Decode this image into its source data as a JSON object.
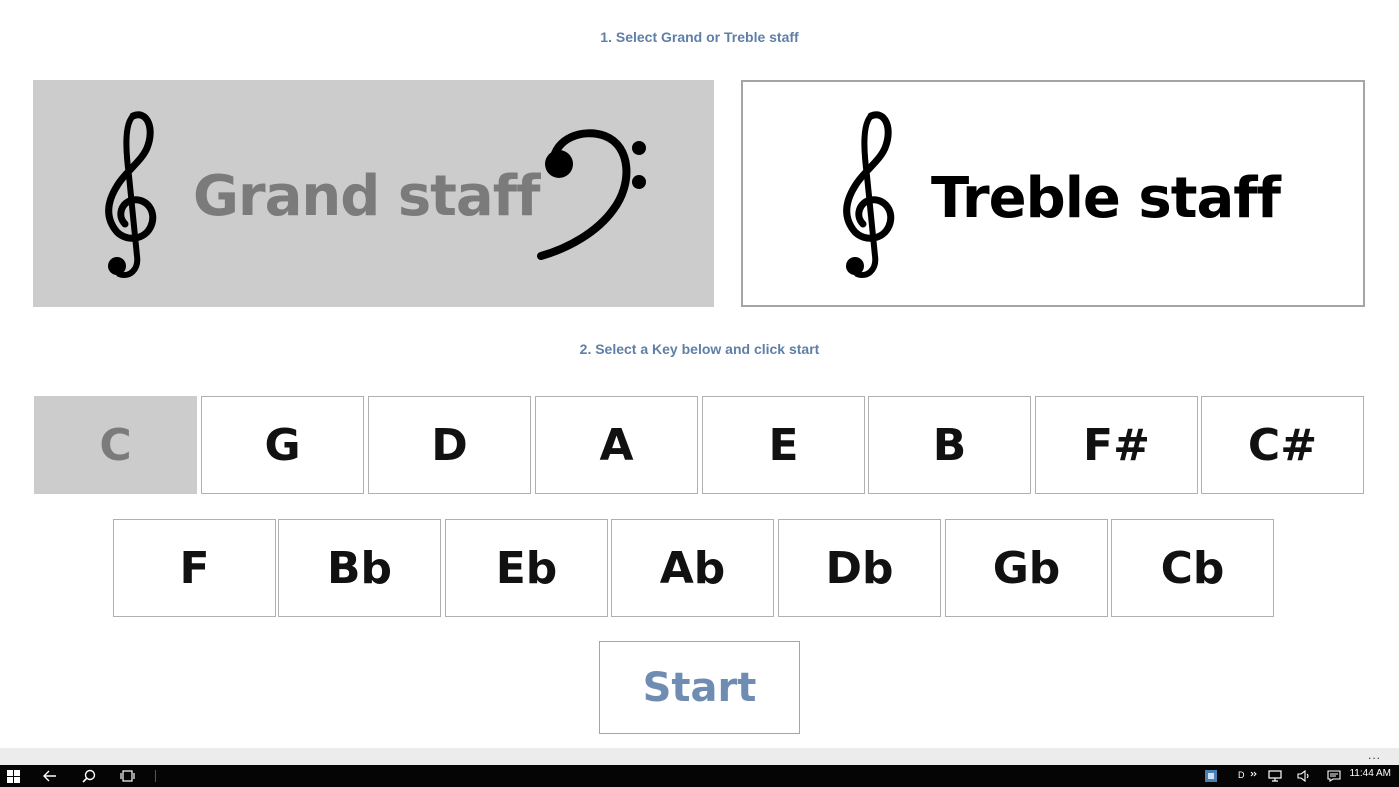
{
  "steps": {
    "step1": "1. Select Grand or Treble staff",
    "step2": "2. Select a Key below and click start"
  },
  "staff_options": {
    "grand": {
      "label": "Grand staff",
      "selected": true
    },
    "treble": {
      "label": "Treble staff",
      "selected": false
    }
  },
  "keys_row1": [
    "C",
    "G",
    "D",
    "A",
    "E",
    "B",
    "F#",
    "C#"
  ],
  "keys_row2": [
    "F",
    "Bb",
    "Eb",
    "Ab",
    "Db",
    "Gb",
    "Cb"
  ],
  "selected_key": "C",
  "start_label": "Start",
  "appbar": {
    "more": "..."
  },
  "taskbar": {
    "ime_indicator": "D",
    "time": "11:44 AM",
    "icons": [
      "windows-start-icon",
      "back-arrow-icon",
      "search-icon",
      "task-view-icon",
      "notification-app-icon",
      "chevron-icon",
      "network-icon",
      "volume-icon",
      "action-center-icon"
    ]
  },
  "colors": {
    "accent_text": "#5f7fa6",
    "start_text": "#6f8db3",
    "selected_bg": "#cccccc",
    "selected_text": "#7b7b7b"
  }
}
